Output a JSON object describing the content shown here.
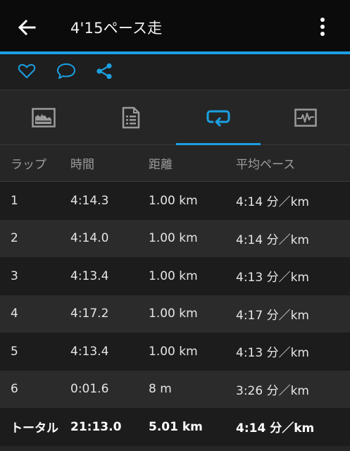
{
  "app_bar": {
    "title": "4'15ペース走"
  },
  "icons": {
    "back": "arrow-left-icon",
    "more": "more-vert-icon",
    "like": "heart-icon",
    "comment": "comment-icon",
    "share": "share-icon",
    "tab_overview": "chart-card-icon",
    "tab_details": "document-list-icon",
    "tab_laps": "loop-icon",
    "tab_graphs": "activity-graph-icon"
  },
  "colors": {
    "accent": "#1ba0e2",
    "background": "#262626",
    "appbar": "#0b0b0b"
  },
  "tabs": {
    "active_index": 2
  },
  "laps_table": {
    "headers": [
      "ラップ",
      "時間",
      "距離",
      "平均ペース"
    ],
    "rows": [
      {
        "lap": "1",
        "time": "4:14.3",
        "distance": "1.00 km",
        "pace": "4:14 分／km"
      },
      {
        "lap": "2",
        "time": "4:14.0",
        "distance": "1.00 km",
        "pace": "4:14 分／km"
      },
      {
        "lap": "3",
        "time": "4:13.4",
        "distance": "1.00 km",
        "pace": "4:13 分／km"
      },
      {
        "lap": "4",
        "time": "4:17.2",
        "distance": "1.00 km",
        "pace": "4:17 分／km"
      },
      {
        "lap": "5",
        "time": "4:13.4",
        "distance": "1.00 km",
        "pace": "4:13 分／km"
      },
      {
        "lap": "6",
        "time": "0:01.6",
        "distance": "8 m",
        "pace": "3:26 分／km"
      }
    ],
    "total": {
      "label": "トータル",
      "time": "21:13.0",
      "distance": "5.01 km",
      "pace": "4:14 分／km"
    }
  }
}
